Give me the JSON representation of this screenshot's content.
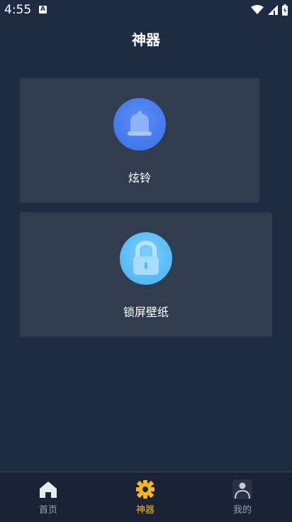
{
  "status_bar": {
    "time": "4:55",
    "badge": "A"
  },
  "header": {
    "title": "神器"
  },
  "cards": [
    {
      "label": "炫铃",
      "icon": "bell-icon",
      "color": "#4a7ff0"
    },
    {
      "label": "锁屏壁纸",
      "icon": "lock-icon",
      "color": "#5dbdf7"
    }
  ],
  "bottom_nav": {
    "items": [
      {
        "label": "首页",
        "icon": "home-icon",
        "active": false
      },
      {
        "label": "神器",
        "icon": "gear-icon",
        "active": true
      },
      {
        "label": "我的",
        "icon": "person-icon",
        "active": false
      }
    ],
    "active_color": "#f5b622",
    "inactive_color": "#9aa3b0"
  }
}
